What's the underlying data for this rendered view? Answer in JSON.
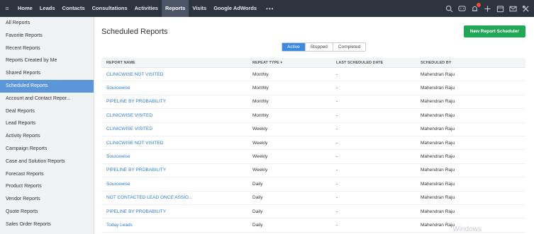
{
  "nav": {
    "items": [
      {
        "label": "Home"
      },
      {
        "label": "Leads"
      },
      {
        "label": "Contacts"
      },
      {
        "label": "Consultations"
      },
      {
        "label": "Activities"
      },
      {
        "label": "Reports",
        "active": true
      },
      {
        "label": "Visits"
      },
      {
        "label": "Google AdWords"
      }
    ],
    "more": "•••",
    "icons": [
      "search-icon",
      "chat-icon",
      "bell-icon",
      "plus-icon",
      "calendar-icon",
      "mail-icon",
      "tools-icon"
    ]
  },
  "sidebar": {
    "items": [
      {
        "label": "All Reports"
      },
      {
        "label": "Favorite Reports"
      },
      {
        "label": "Recent Reports"
      },
      {
        "label": "Reports Created by Me"
      },
      {
        "label": "Shared Reports"
      },
      {
        "label": "Scheduled Reports",
        "active": true
      },
      {
        "label": "Account and Contact Repor..."
      },
      {
        "label": "Deal Reports"
      },
      {
        "label": "Lead Reports"
      },
      {
        "label": "Activity Reports"
      },
      {
        "label": "Campaign Reports"
      },
      {
        "label": "Case and Solution Reports"
      },
      {
        "label": "Forecast Reports"
      },
      {
        "label": "Product Reports"
      },
      {
        "label": "Vendor Reports"
      },
      {
        "label": "Quote Reports"
      },
      {
        "label": "Sales Order Reports"
      }
    ]
  },
  "main": {
    "title": "Scheduled Reports",
    "new_button": "New Report Scheduler",
    "tabs": [
      {
        "label": "Active",
        "active": true
      },
      {
        "label": "Stopped"
      },
      {
        "label": "Completed"
      }
    ],
    "columns": [
      "REPORT NAME",
      "REPEAT TYPE ▾",
      "LAST SCHEDULED DATE",
      "SCHEDULED BY"
    ],
    "rows": [
      {
        "name": "CLINICWISE NOT VISITED",
        "repeat": "Monthly",
        "last": "-",
        "by": "Mahendran Raju"
      },
      {
        "name": "Sourcewise",
        "repeat": "Monthly",
        "last": "-",
        "by": "Mahendran Raju"
      },
      {
        "name": "PIPELINE BY PROBABILITY",
        "repeat": "Monthly",
        "last": "-",
        "by": "Mahendran Raju"
      },
      {
        "name": "CLINICWISE VISITED",
        "repeat": "Monthly",
        "last": "-",
        "by": "Mahendran Raju"
      },
      {
        "name": "CLINICWISE VISITED",
        "repeat": "Weekly",
        "last": "-",
        "by": "Mahendran Raju"
      },
      {
        "name": "CLINICWISE NOT VISITED",
        "repeat": "Weekly",
        "last": "-",
        "by": "Mahendran Raju"
      },
      {
        "name": "Sourcewise",
        "repeat": "Weekly",
        "last": "-",
        "by": "Mahendran Raju"
      },
      {
        "name": "PIPELINE BY PROBABILITY",
        "repeat": "Weekly",
        "last": "-",
        "by": "Mahendran Raju"
      },
      {
        "name": "Sourcewise",
        "repeat": "Daily",
        "last": "-",
        "by": "Mahendran Raju"
      },
      {
        "name": "NOT CONTACTED LEAD ONCE ASSIG...",
        "repeat": "Daily",
        "last": "-",
        "by": "Mahendran Raju"
      },
      {
        "name": "PIPELINE BY PROBABILITY",
        "repeat": "Daily",
        "last": "-",
        "by": "Mahendran Raju"
      },
      {
        "name": "Today Leads",
        "repeat": "Daily",
        "last": "-",
        "by": "Mahendran Raju"
      }
    ],
    "watermark": "Windows"
  }
}
